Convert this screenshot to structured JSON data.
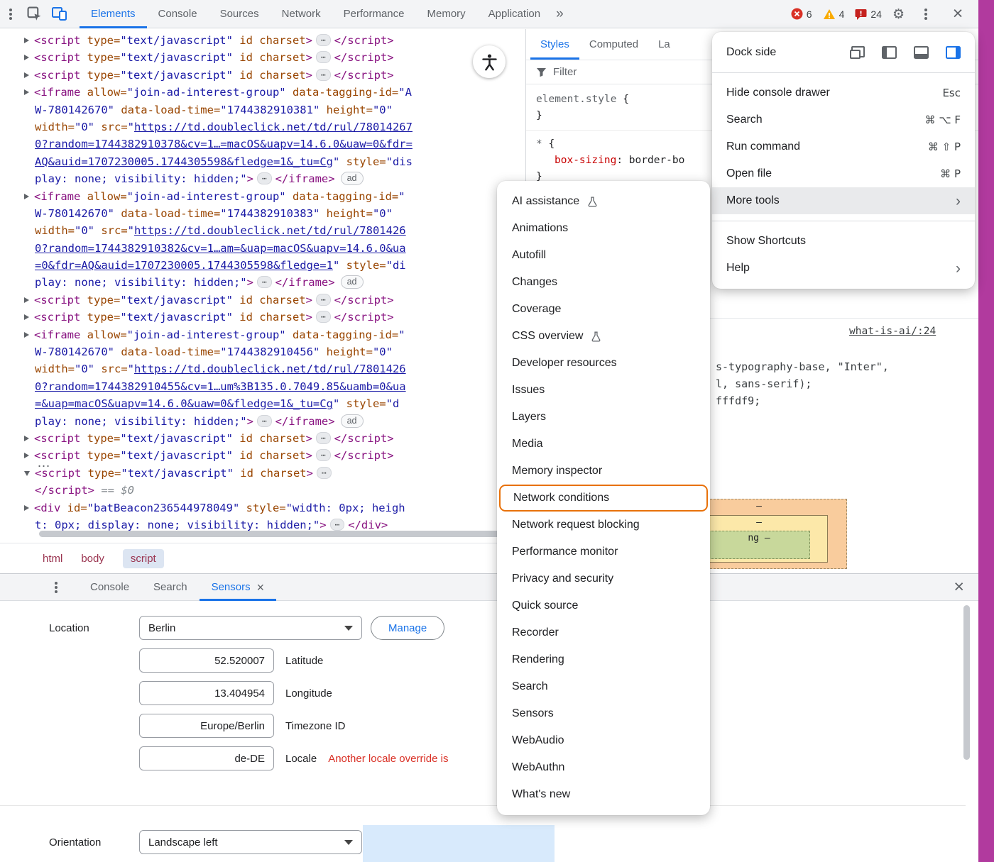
{
  "accent": {
    "magenta": "#b13a9e",
    "blue": "#1a73e8",
    "orange": "#e8710a",
    "red": "#d93025",
    "yellow": "#f9ab00"
  },
  "top_toolbar": {
    "tabs": [
      "Elements",
      "Console",
      "Sources",
      "Network",
      "Performance",
      "Memory",
      "Application"
    ],
    "selected_tab": "Elements",
    "more_tabs_chevron": "»",
    "error_count": "6",
    "warning_count": "4",
    "issue_count": "24"
  },
  "elements_panel": {
    "hover_ellipsis": "…",
    "lines": [
      {
        "s": [
          [
            "a",
            ""
          ],
          [
            "t",
            "<script "
          ],
          [
            "n",
            "type="
          ],
          [
            "v",
            "\"text/javascript\""
          ],
          [
            "n",
            " id charset"
          ],
          [
            "t",
            ">"
          ],
          [
            "e",
            "⋯"
          ],
          [
            "t",
            "</script>"
          ]
        ]
      },
      {
        "s": [
          [
            "a",
            ""
          ],
          [
            "t",
            "<script "
          ],
          [
            "n",
            "type="
          ],
          [
            "v",
            "\"text/javascript\""
          ],
          [
            "n",
            " id charset"
          ],
          [
            "t",
            ">"
          ],
          [
            "e",
            "⋯"
          ],
          [
            "t",
            "</script>"
          ]
        ]
      },
      {
        "s": [
          [
            "a",
            ""
          ],
          [
            "t",
            "<script "
          ],
          [
            "n",
            "type="
          ],
          [
            "v",
            "\"text/javascript\""
          ],
          [
            "n",
            " id charset"
          ],
          [
            "t",
            ">"
          ],
          [
            "e",
            "⋯"
          ],
          [
            "t",
            "</script>"
          ]
        ]
      },
      {
        "s": [
          [
            "a",
            ""
          ],
          [
            "t",
            "<iframe "
          ],
          [
            "n",
            "allow="
          ],
          [
            "v",
            "\"join-ad-interest-group\""
          ],
          [
            "n",
            " data-tagging-id="
          ],
          [
            "v",
            "\"A"
          ]
        ]
      },
      {
        "i": 1,
        "s": [
          [
            "v",
            "W-780142670\""
          ],
          [
            "n",
            " data-load-time="
          ],
          [
            "v",
            "\"1744382910381\""
          ],
          [
            "n",
            " height="
          ],
          [
            "v",
            "\"0\""
          ]
        ]
      },
      {
        "i": 1,
        "s": [
          [
            "n",
            "width="
          ],
          [
            "v",
            "\"0\""
          ],
          [
            "n",
            " src="
          ],
          [
            "v",
            "\""
          ],
          [
            "l",
            "https://td.doubleclick.net/td/rul/78014267"
          ]
        ]
      },
      {
        "i": 1,
        "s": [
          [
            "l",
            "0?random=1744382910378&cv=1…=macOS&uapv=14.6.0&uaw=0&fdr="
          ]
        ]
      },
      {
        "i": 1,
        "s": [
          [
            "l",
            "AQ&auid=1707230005.1744305598&fledge=1&_tu=Cg"
          ],
          [
            "v",
            "\""
          ],
          [
            "n",
            " style="
          ],
          [
            "v",
            "\"dis"
          ]
        ]
      },
      {
        "i": 1,
        "s": [
          [
            "v",
            "play: none; visibility: hidden;\""
          ],
          [
            "t",
            ">"
          ],
          [
            "e",
            "⋯"
          ],
          [
            "t",
            "</iframe>"
          ],
          [
            "b",
            "ad"
          ]
        ]
      },
      {
        "s": [
          [
            "a",
            ""
          ],
          [
            "t",
            "<iframe "
          ],
          [
            "n",
            "allow="
          ],
          [
            "v",
            "\"join-ad-interest-group\""
          ],
          [
            "n",
            " data-tagging-id="
          ],
          [
            "v",
            "\""
          ]
        ]
      },
      {
        "i": 1,
        "s": [
          [
            "v",
            "W-780142670\""
          ],
          [
            "n",
            " data-load-time="
          ],
          [
            "v",
            "\"1744382910383\""
          ],
          [
            "n",
            " height="
          ],
          [
            "v",
            "\"0\""
          ]
        ]
      },
      {
        "i": 1,
        "s": [
          [
            "n",
            "width="
          ],
          [
            "v",
            "\"0\""
          ],
          [
            "n",
            " src="
          ],
          [
            "v",
            "\""
          ],
          [
            "l",
            "https://td.doubleclick.net/td/rul/7801426"
          ]
        ]
      },
      {
        "i": 1,
        "s": [
          [
            "l",
            "0?random=1744382910382&cv=1…am=&uap=macOS&uapv=14.6.0&ua"
          ]
        ]
      },
      {
        "i": 1,
        "s": [
          [
            "l",
            "=0&fdr=AQ&auid=1707230005.1744305598&fledge=1"
          ],
          [
            "v",
            "\""
          ],
          [
            "n",
            " style="
          ],
          [
            "v",
            "\"di"
          ]
        ]
      },
      {
        "i": 1,
        "s": [
          [
            "v",
            "play: none; visibility: hidden;\""
          ],
          [
            "t",
            ">"
          ],
          [
            "e",
            "⋯"
          ],
          [
            "t",
            "</iframe>"
          ],
          [
            "b",
            "ad"
          ]
        ]
      },
      {
        "s": [
          [
            "a",
            ""
          ],
          [
            "t",
            "<script "
          ],
          [
            "n",
            "type="
          ],
          [
            "v",
            "\"text/javascript\""
          ],
          [
            "n",
            " id charset"
          ],
          [
            "t",
            ">"
          ],
          [
            "e",
            "⋯"
          ],
          [
            "t",
            "</script>"
          ]
        ]
      },
      {
        "s": [
          [
            "a",
            ""
          ],
          [
            "t",
            "<script "
          ],
          [
            "n",
            "type="
          ],
          [
            "v",
            "\"text/javascript\""
          ],
          [
            "n",
            " id charset"
          ],
          [
            "t",
            ">"
          ],
          [
            "e",
            "⋯"
          ],
          [
            "t",
            "</script>"
          ]
        ]
      },
      {
        "s": [
          [
            "a",
            ""
          ],
          [
            "t",
            "<iframe "
          ],
          [
            "n",
            "allow="
          ],
          [
            "v",
            "\"join-ad-interest-group\""
          ],
          [
            "n",
            " data-tagging-id="
          ],
          [
            "v",
            "\""
          ]
        ]
      },
      {
        "i": 1,
        "s": [
          [
            "v",
            "W-780142670\""
          ],
          [
            "n",
            " data-load-time="
          ],
          [
            "v",
            "\"1744382910456\""
          ],
          [
            "n",
            " height="
          ],
          [
            "v",
            "\"0\""
          ]
        ]
      },
      {
        "i": 1,
        "s": [
          [
            "n",
            "width="
          ],
          [
            "v",
            "\"0\""
          ],
          [
            "n",
            " src="
          ],
          [
            "v",
            "\""
          ],
          [
            "l",
            "https://td.doubleclick.net/td/rul/7801426"
          ]
        ]
      },
      {
        "i": 1,
        "s": [
          [
            "l",
            "0?random=1744382910455&cv=1…um%3B135.0.7049.85&uamb=0&ua"
          ]
        ]
      },
      {
        "i": 1,
        "s": [
          [
            "l",
            "=&uap=macOS&uapv=14.6.0&uaw=0&fledge=1&_tu=Cg"
          ],
          [
            "v",
            "\""
          ],
          [
            "n",
            " style="
          ],
          [
            "v",
            "\"d"
          ]
        ]
      },
      {
        "i": 1,
        "s": [
          [
            "v",
            "play: none; visibility: hidden;\""
          ],
          [
            "t",
            ">"
          ],
          [
            "e",
            "⋯"
          ],
          [
            "t",
            "</iframe>"
          ],
          [
            "b",
            "ad"
          ]
        ]
      },
      {
        "s": [
          [
            "a",
            ""
          ],
          [
            "t",
            "<script "
          ],
          [
            "n",
            "type="
          ],
          [
            "v",
            "\"text/javascript\""
          ],
          [
            "n",
            " id charset"
          ],
          [
            "t",
            ">"
          ],
          [
            "e",
            "⋯"
          ],
          [
            "t",
            "</script>"
          ]
        ]
      },
      {
        "s": [
          [
            "a",
            ""
          ],
          [
            "t",
            "<script "
          ],
          [
            "n",
            "type="
          ],
          [
            "v",
            "\"text/javascript\""
          ],
          [
            "n",
            " id charset"
          ],
          [
            "t",
            ">"
          ],
          [
            "e",
            "⋯"
          ],
          [
            "t",
            "</script>"
          ]
        ]
      },
      {
        "s": [
          [
            "d",
            ""
          ],
          [
            "t",
            "<script "
          ],
          [
            "n",
            "type="
          ],
          [
            "v",
            "\"text/javascript\""
          ],
          [
            "n",
            " id charset"
          ],
          [
            "t",
            ">"
          ],
          [
            "e",
            "⋯"
          ]
        ]
      },
      {
        "i": 1,
        "s": [
          [
            "t",
            "</script>"
          ],
          [
            "m",
            " == $0"
          ]
        ]
      },
      {
        "s": [
          [
            "a",
            ""
          ],
          [
            "t",
            "<div "
          ],
          [
            "n",
            "id="
          ],
          [
            "v",
            "\"batBeacon236544978049\""
          ],
          [
            "n",
            " style="
          ],
          [
            "v",
            "\"width: 0px; heigh"
          ]
        ]
      },
      {
        "i": 1,
        "s": [
          [
            "v",
            "t: 0px; display: none; visibility: hidden;\""
          ],
          [
            "t",
            ">"
          ],
          [
            "e",
            "⋯"
          ],
          [
            "t",
            "</div>"
          ]
        ]
      }
    ],
    "breadcrumbs": [
      {
        "label": "html"
      },
      {
        "label": "body"
      },
      {
        "label": "script",
        "selected": true
      }
    ]
  },
  "styles_panel": {
    "tabs": [
      {
        "label": "Styles",
        "selected": true
      },
      {
        "label": "Computed"
      },
      {
        "label": "La"
      }
    ],
    "filter_placeholder": "Filter",
    "rules": [
      {
        "segs": [
          [
            "sel",
            "element.style "
          ],
          [
            "brace",
            "{"
          ]
        ]
      },
      {
        "segs": [
          [
            "brace",
            "}"
          ]
        ]
      },
      {
        "sep": true
      },
      {
        "segs": [
          [
            "sel",
            "* "
          ],
          [
            "brace",
            "{"
          ]
        ]
      },
      {
        "indent": true,
        "segs": [
          [
            "prop",
            "box-sizing"
          ],
          [
            "plain",
            ": "
          ],
          [
            "val",
            "border-bo"
          ]
        ]
      },
      {
        "segs": [
          [
            "brace",
            "}"
          ]
        ]
      }
    ],
    "source_link": "what-is-ai/:24",
    "source_lines": [
      "s-typography-base, \"Inter\",",
      "l, sans-serif);",
      "fffdf9;"
    ]
  },
  "box_model": {
    "margin": "–",
    "border": "–",
    "padding": "ng  –"
  },
  "main_menu": {
    "dock_side_label": "Dock side",
    "items": [
      {
        "label": "Hide console drawer",
        "shortcut": "Esc"
      },
      {
        "label": "Search",
        "shortcut": "⌘ ⌥ F"
      },
      {
        "label": "Run command",
        "shortcut": "⌘ ⇧ P"
      },
      {
        "label": "Open file",
        "shortcut": "⌘ P"
      },
      {
        "label": "More tools",
        "chevron": "›",
        "highlighted": true
      },
      {
        "sep": true
      },
      {
        "label": "Show Shortcuts"
      },
      {
        "label": "Help",
        "chevron": "›"
      }
    ]
  },
  "more_tools_menu": {
    "items": [
      {
        "label": "AI assistance",
        "flask": true
      },
      {
        "label": "Animations"
      },
      {
        "label": "Autofill"
      },
      {
        "label": "Changes"
      },
      {
        "label": "Coverage"
      },
      {
        "label": "CSS overview",
        "flask": true
      },
      {
        "label": "Developer resources"
      },
      {
        "label": "Issues"
      },
      {
        "label": "Layers"
      },
      {
        "label": "Media"
      },
      {
        "label": "Memory inspector"
      },
      {
        "label": "Network conditions",
        "highlighted": true
      },
      {
        "label": "Network request blocking"
      },
      {
        "label": "Performance monitor"
      },
      {
        "label": "Privacy and security"
      },
      {
        "label": "Quick source"
      },
      {
        "label": "Recorder"
      },
      {
        "label": "Rendering"
      },
      {
        "label": "Search"
      },
      {
        "label": "Sensors"
      },
      {
        "label": "WebAudio"
      },
      {
        "label": "WebAuthn"
      },
      {
        "label": "What's new"
      }
    ]
  },
  "drawer": {
    "tabs": [
      {
        "label": "Console"
      },
      {
        "label": "Search"
      },
      {
        "label": "Sensors",
        "selected": true,
        "closable": true
      }
    ]
  },
  "sensors": {
    "location_label": "Location",
    "location_value": "Berlin",
    "manage_label": "Manage",
    "fields": [
      {
        "value": "52.520007",
        "label": "Latitude"
      },
      {
        "value": "13.404954",
        "label": "Longitude"
      },
      {
        "value": "Europe/Berlin",
        "label": "Timezone ID"
      },
      {
        "value": "de-DE",
        "label": "Locale",
        "warning": "Another locale override is"
      }
    ],
    "orientation_label": "Orientation",
    "orientation_value": "Landscape left"
  }
}
